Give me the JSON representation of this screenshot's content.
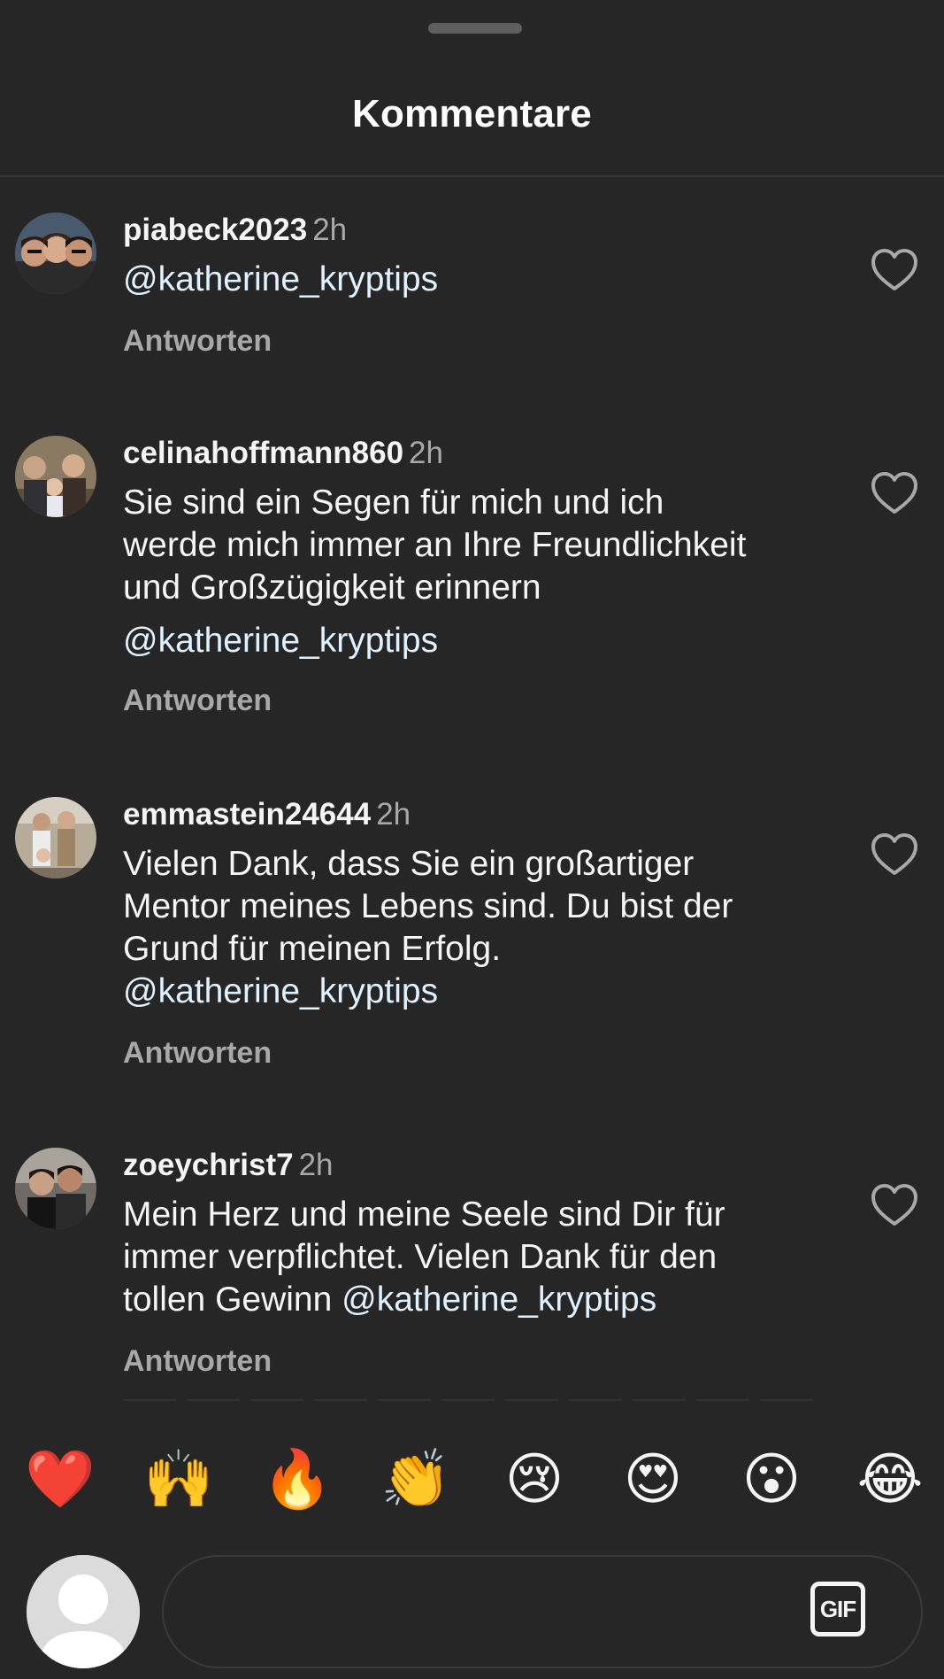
{
  "header": {
    "title": "Kommentare"
  },
  "comments": [
    {
      "username": "piabeck2023",
      "time": "2h",
      "lines": [],
      "mention_lines": [
        "@katherine_kryptips"
      ],
      "reply_label": "Antworten"
    },
    {
      "username": "celinahoffmann860",
      "time": "2h",
      "lines": [
        "Sie sind ein Segen für mich und ich",
        "werde mich immer an Ihre Freundlichkeit",
        "und Großzügigkeit erinnern"
      ],
      "mention_lines": [
        "@katherine_kryptips"
      ],
      "reply_label": "Antworten"
    },
    {
      "username": "emmastein24644",
      "time": "2h",
      "lines": [
        "Vielen Dank, dass Sie ein großartiger",
        "Mentor meines Lebens sind.  Du bist der",
        "Grund für meinen Erfolg."
      ],
      "mention_lines": [
        "@katherine_kryptips"
      ],
      "reply_label": "Antworten"
    },
    {
      "username": "zoeychrist7",
      "time": "2h",
      "lines": [
        "Mein Herz und meine Seele sind Dir für",
        "immer verpflichtet.  Vielen Dank für den"
      ],
      "last_line_prefix": "tollen Gewinn ",
      "last_line_mention": "@katherine_kryptips",
      "reply_label": "Antworten"
    }
  ],
  "emoji_bar": [
    "❤️",
    "🙌",
    "🔥",
    "👏",
    "😢",
    "😍",
    "😮",
    "😂"
  ],
  "composer": {
    "placeholder": "",
    "gif_label": "GIF"
  },
  "colors": {
    "background": "#262626",
    "text_primary": "#f5f5f5",
    "text_secondary": "#a8a8a8",
    "mention": "#e0f1ff",
    "divider": "#363636"
  }
}
